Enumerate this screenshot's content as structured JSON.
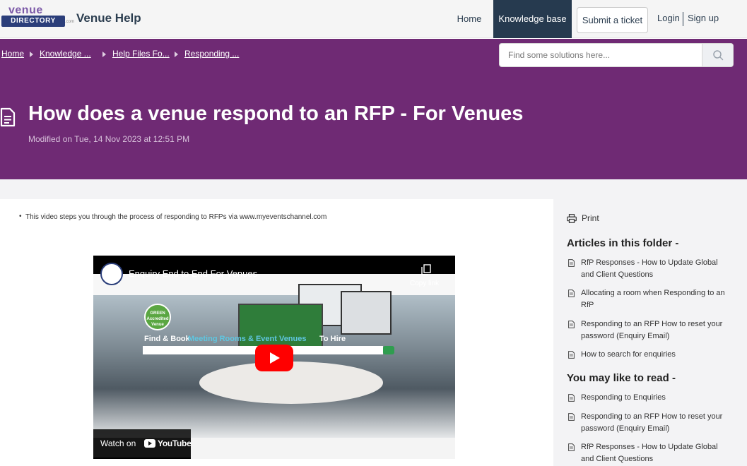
{
  "header": {
    "logo_top": "venue",
    "logo_main": "DIRECTORY",
    "logo_suffix": ".com",
    "title": "Venue Help",
    "nav": {
      "home": "Home",
      "knowledge_base": "Knowledge base",
      "submit_ticket": "Submit a ticket",
      "login": "Login",
      "signup": "Sign up"
    }
  },
  "breadcrumb": [
    "Home",
    "Knowledge ...",
    "Help Files Fo...",
    "Responding ..."
  ],
  "search": {
    "placeholder": "Find some solutions here..."
  },
  "article": {
    "title": "How does a venue respond to an RFP - For Venues",
    "modified": "Modified on Tue, 14 Nov 2023 at 12:51 PM",
    "bullet": "This video steps you through the process of responding to RFPs via www.myeventschannel.com"
  },
  "video": {
    "title": "Enquiry End to End For Venues",
    "copy_link": "Copy link",
    "watch_on": "Watch on",
    "youtube": "YouTube",
    "overlay_find": "Find & Book",
    "overlay_highlight": "Meeting Rooms & Event Venues",
    "overlay_to_hire": "To Hire",
    "badge": "GREEN Accredited Venue"
  },
  "sidebar": {
    "print": "Print",
    "folder_heading": "Articles in this folder -",
    "folder_items": [
      "RfP Responses - How to Update Global and Client Questions",
      "Allocating a room when Responding to an RfP",
      "Responding to an RFP How to reset your password (Enquiry Email)",
      "How to search for enquiries"
    ],
    "read_heading": "You may like to read -",
    "read_items": [
      "Responding to Enquiries",
      "Responding to an RFP How to reset your password (Enquiry Email)",
      "RfP Responses - How to Update Global and Client Questions"
    ]
  },
  "colors": {
    "hero": "#6f2a74",
    "nav_active": "#263a4f",
    "youtube_red": "#ff0000"
  }
}
